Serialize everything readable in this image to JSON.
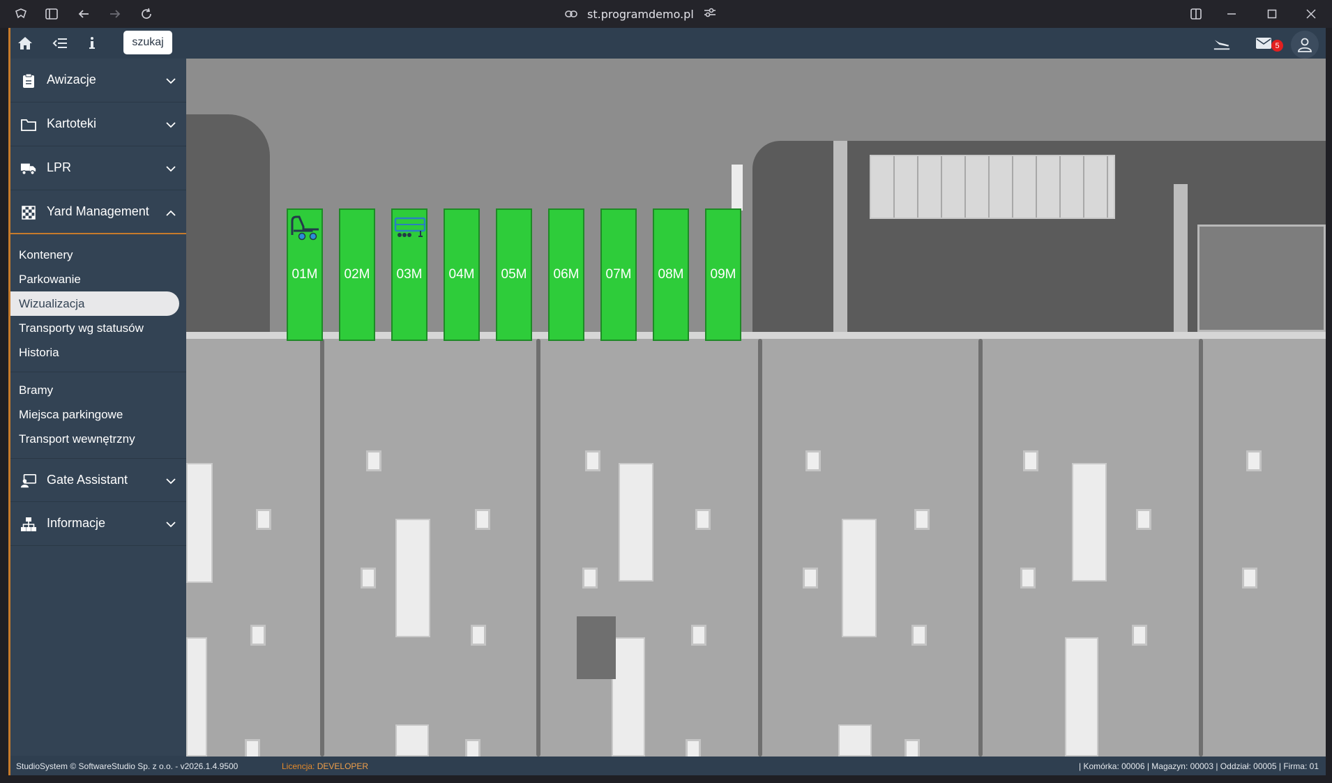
{
  "browser": {
    "url": "st.programdemo.pl",
    "icons": [
      "app-logo-icon",
      "sidebar-toggle-icon",
      "back-arrow-icon",
      "forward-arrow-icon",
      "reload-icon",
      "link-icon",
      "site-settings-icon",
      "split-view-icon",
      "minimize-icon",
      "maximize-icon",
      "close-icon"
    ]
  },
  "topbar": {
    "search_label": "szukaj",
    "mail_count": "5"
  },
  "sidebar": {
    "sections": [
      {
        "label": "Awizacje",
        "icon": "clipboard-icon"
      },
      {
        "label": "Kartoteki",
        "icon": "folder-icon"
      },
      {
        "label": "LPR",
        "icon": "truck-icon"
      },
      {
        "label": "Yard Management",
        "icon": "checkered-flag-icon"
      },
      {
        "label": "Gate Assistant",
        "icon": "person-desk-icon"
      },
      {
        "label": "Informacje",
        "icon": "sitemap-icon"
      }
    ],
    "yard_items": [
      "Kontenery",
      "Parkowanie",
      "Wizualizacja",
      "Transporty wg statusów",
      "Historia"
    ],
    "yard_items_2": [
      "Bramy",
      "Miejsca parkingowe",
      "Transport wewnętrzny"
    ],
    "active_item": "Wizualizacja"
  },
  "map": {
    "slots": [
      {
        "label": "01M",
        "vehicle": "tractor"
      },
      {
        "label": "02M",
        "vehicle": ""
      },
      {
        "label": "03M",
        "vehicle": "trailer"
      },
      {
        "label": "04M",
        "vehicle": ""
      },
      {
        "label": "05M",
        "vehicle": ""
      },
      {
        "label": "06M",
        "vehicle": ""
      },
      {
        "label": "07M",
        "vehicle": ""
      },
      {
        "label": "08M",
        "vehicle": ""
      },
      {
        "label": "09M",
        "vehicle": ""
      }
    ],
    "slot_color": "#2ecc3a"
  },
  "footer": {
    "copyright": "StudioSystem © SoftwareStudio Sp. z o.o. - v2026.1.4.9500",
    "license_label": "Licencja:",
    "license_value": "DEVELOPER",
    "context": "| Komórka: 00006 | Magazyn: 00003 | Oddział: 00005 | Firma: 01"
  },
  "colors": {
    "accent": "#c77b2b",
    "sidebar_bg": "#334354",
    "badge": "#e32020"
  }
}
